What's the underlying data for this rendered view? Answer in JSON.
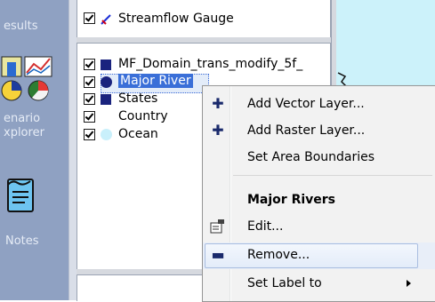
{
  "nav": {
    "results_label": "esults",
    "scenario_label_1": "enario",
    "scenario_label_2": "xplorer",
    "notes_label": "Notes"
  },
  "top_panel": {
    "layer": {
      "label": "Streamflow Gauge",
      "checked": true
    }
  },
  "layers": [
    {
      "label": "MF_Domain_trans_modify_5f_",
      "checked": true,
      "swatch": "#1a237e"
    },
    {
      "label": "Major River",
      "checked": true,
      "swatch": "#1a237e",
      "selected": true
    },
    {
      "label": "States",
      "checked": true,
      "swatch": "#1a237e"
    },
    {
      "label": "Country",
      "checked": true,
      "swatch": ""
    },
    {
      "label": "Ocean",
      "checked": true,
      "swatch": "#c9f0fb"
    }
  ],
  "context_menu": {
    "add_vector": "Add Vector Layer...",
    "add_raster": "Add Raster Layer...",
    "set_area": "Set Area Boundaries",
    "section_title": "Major Rivers",
    "edit": "Edit...",
    "remove": "Remove...",
    "set_label": "Set Label to"
  },
  "colors": {
    "nav_bg": "#8fa1c2",
    "map_bg": "#ccf2fa",
    "menu_bg": "#f2f2f2",
    "layer_swatch": "#1a237e"
  },
  "icons": [
    "check-icon",
    "streamflow-gauge-icon",
    "scenario-explorer-icon",
    "notes-icon",
    "plus-icon",
    "edit-icon",
    "minus-icon",
    "submenu-arrow-icon"
  ]
}
